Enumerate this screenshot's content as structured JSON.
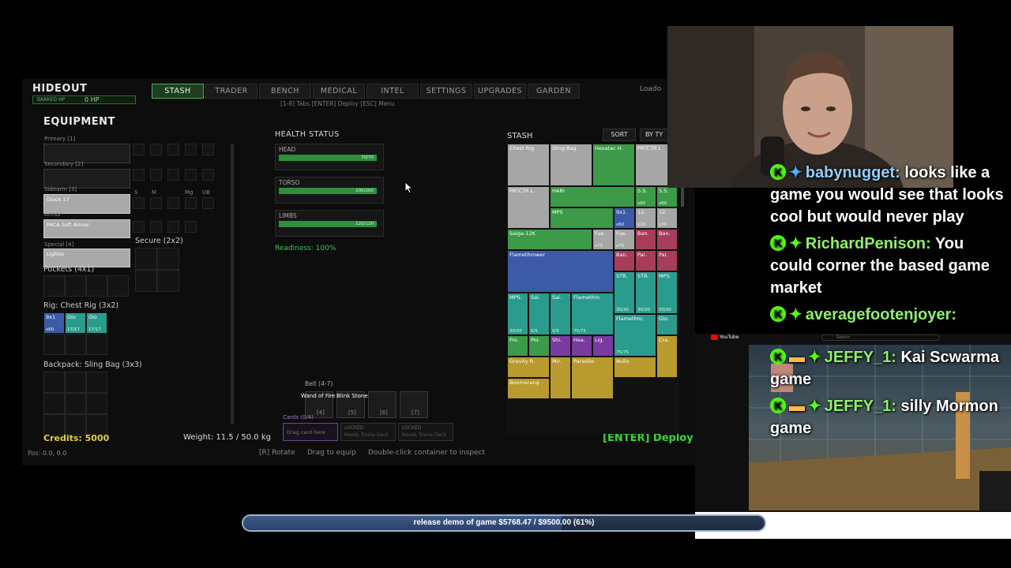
{
  "game": {
    "title": "HIDEOUT",
    "banked_label": "BANKED HP",
    "banked_value": "0 HP",
    "tabs": [
      "STASH",
      "TRADER",
      "BENCH",
      "MEDICAL",
      "INTEL",
      "SETTINGS",
      "UPGRADES",
      "GARDEN"
    ],
    "active_tab": "STASH",
    "loadout_partial": "Loado",
    "tab_hint": "[1-8] Tabs  [ENTER] Deploy  [ESC] Menu",
    "equipment_title": "EQUIPMENT",
    "slots": {
      "primary": "Primary [1]",
      "secondary": "Secondary [2]",
      "sidearm": "Sidearm [3]",
      "sidearm_item": "Glock 17",
      "armor": "Armor",
      "armor_item": "PACA Soft Armor",
      "special": "Special [4]",
      "special_item": "Lighter",
      "secure": "Secure (2x2)",
      "pockets": "Pockets (4x1)",
      "rig": "Rig: Chest Rig (3x2)",
      "backpack": "Backpack: Sling Bag (3x3)"
    },
    "mod_labels": [
      "S",
      "M",
      "Mg",
      "UB"
    ],
    "rig_items": [
      {
        "name": "9x1",
        "count": "x60",
        "color": "bl"
      },
      {
        "name": "Glo",
        "count": "17/17",
        "color": "tl"
      },
      {
        "name": "Glo",
        "count": "17/17",
        "color": "tl"
      }
    ],
    "health_title": "HEALTH STATUS",
    "health": [
      {
        "label": "HEAD",
        "value": "70/70",
        "fill": 1.0
      },
      {
        "label": "TORSO",
        "value": "200/200",
        "fill": 1.0
      },
      {
        "label": "LIMBS",
        "value": "120/120",
        "fill": 1.0
      }
    ],
    "readiness": "Readiness: 100%",
    "belt_label": "Belt (4-7)",
    "belt_items": [
      "Wand of Fire",
      "Blink Stone"
    ],
    "belt_keys": [
      "[4]",
      "[5]",
      "[6]",
      "[7]"
    ],
    "cards_label": "Cards (0/4)",
    "cards": [
      "Drag card here",
      "LOCKED",
      "Needs Triune Deck",
      "LOCKED",
      "Needs Triune Deck"
    ],
    "credits": "Credits: 5000",
    "weight": "Weight: 11.5 / 50.0 kg",
    "pos": "Pos: 0.0, 0.0",
    "hints": [
      "[R] Rotate",
      "Drag to equip",
      "Double-click container to inspect"
    ],
    "deploy": "[ENTER] Deploy",
    "stash_title": "STASH",
    "sort": "SORT",
    "by_type": "BY TY",
    "stash_items": {
      "chest_rig": "Chest Rig",
      "sling_bag": "Sling Bag",
      "hexatac": "Hexatac H.",
      "pratctr1": "PRTCTR L",
      "pratctr2": "PRTCTR L.",
      "hari": "HARI",
      "ss1": "S.S.",
      "ss1c": "x60",
      "ss2": "S.S.",
      "ss2c": "x60",
      "mps": "MPS",
      "n9x1": "9x1.",
      "n9x1c": "x60",
      "n12": "12.",
      "n12c": "x20",
      "n12b": "12.",
      "n12bc": "x20",
      "saiga": "Saiga-12K",
      "fue1": "Fue.",
      "fue1c": "x75",
      "fue2": "Fue.",
      "fue2c": "x75",
      "ban1": "Ban.",
      "ban2": "Ban.",
      "flamethrower": "Flamethrower",
      "ban3": "Ban.",
      "pai1": "Pai.",
      "pai2": "Pai.",
      "str1": "STR.",
      "str1c": "30/30",
      "str2": "STR.",
      "str2c": "30/30",
      "mps2": "MPS.",
      "mps2c": "30/30",
      "mps3": "MPS.",
      "mps3c": "30/30",
      "sai1": "Sai.",
      "sai1c": "5/5",
      "sai2": "Sai.",
      "sai2c": "5/5",
      "flame2": "Flamethro.",
      "flame2c": "75/75",
      "flame3": "Flamethro.",
      "flame3c": "75/75",
      "glo": "Glo.",
      "fro": "Fro.",
      "poi": "Poi.",
      "shi": "Shi.",
      "hea": "Hea.",
      "lig": "Lig.",
      "cra": "Cra.",
      "gravity": "Gravity R.",
      "mir": "Mir.",
      "parasite": "Parasite",
      "nullo": "Nullo",
      "boomerang": "Boomerang"
    }
  },
  "chat": [
    {
      "user": "babynugget:",
      "text": "looks like a game you would see that looks cool but would never play"
    },
    {
      "user": "RichardPenison:",
      "text": "You could corner the based game market"
    },
    {
      "user": "averagefootenjoyer:",
      "text": ""
    },
    {
      "user": "JEFFY_1:",
      "text": "Kai Scwarma game"
    },
    {
      "user": "JEFFY_1:",
      "text": "silly Mormon game"
    }
  ],
  "youtube": {
    "brand": "YouTube",
    "search": "Search"
  },
  "progress": {
    "text": "release demo of game $5768.47 / $9500.00 (61%)",
    "fraction": 0.61
  },
  "colors": {
    "accent": "#4caf50",
    "deploy": "#37d63d",
    "credits": "#e6d23a",
    "kick": "#53fc18"
  }
}
